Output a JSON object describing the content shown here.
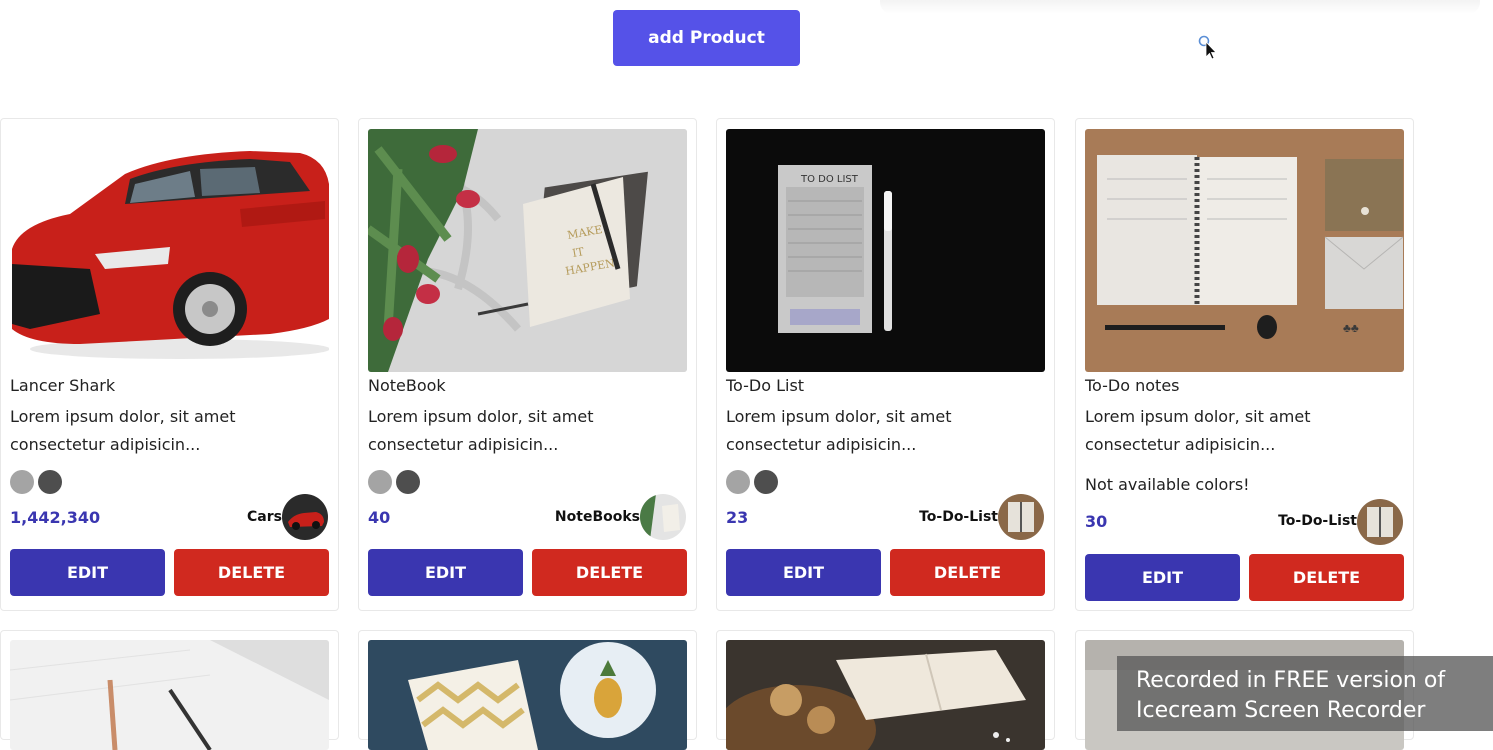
{
  "toolbar": {
    "add_label": "add Product"
  },
  "products": [
    {
      "title": "Lancer Shark",
      "desc": "Lorem ipsum dolor, sit amet consectetur adipisicin...",
      "price": "1,442,340",
      "category": "Cars",
      "colors": [
        "#a4a4a4",
        "#4e4e4e"
      ]
    },
    {
      "title": "NoteBook",
      "desc": "Lorem ipsum dolor, sit amet consectetur adipisicin...",
      "price": "40",
      "category": "NoteBooks",
      "colors": [
        "#a4a4a4",
        "#4e4e4e"
      ]
    },
    {
      "title": "To-Do List",
      "desc": "Lorem ipsum dolor, sit amet consectetur adipisicin...",
      "price": "23",
      "category": "To-Do-List",
      "colors": [
        "#a4a4a4",
        "#4e4e4e"
      ]
    },
    {
      "title": "To-Do notes",
      "desc": "Lorem ipsum dolor, sit amet consectetur adipisicin...",
      "price": "30",
      "category": "To-Do-List",
      "no_colors": "Not available colors!"
    }
  ],
  "buttons": {
    "edit": "EDIT",
    "delete": "DELETE"
  },
  "watermark": {
    "line1": "Recorded in FREE version of",
    "line2": "Icecream   Screen   Recorder"
  },
  "colors": {
    "accent": "#5552e8",
    "edit": "#3a36b0",
    "delete": "#d0291f",
    "price": "#3a36b0"
  }
}
